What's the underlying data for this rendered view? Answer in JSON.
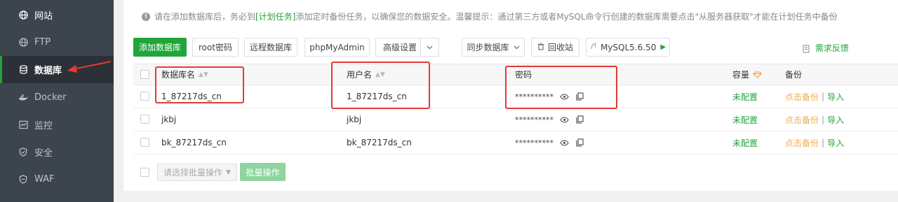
{
  "sidebar": {
    "items": [
      {
        "label": "网站",
        "icon": "globe-icon"
      },
      {
        "label": "FTP",
        "icon": "globe-icon"
      },
      {
        "label": "数据库",
        "icon": "database-icon",
        "active": true
      },
      {
        "label": "Docker",
        "icon": "docker-icon"
      },
      {
        "label": "监控",
        "icon": "monitor-icon"
      },
      {
        "label": "安全",
        "icon": "shield-icon"
      },
      {
        "label": "WAF",
        "icon": "waf-shield-icon"
      }
    ]
  },
  "notice": {
    "prefix": "请在添加数据库后，务必到",
    "link": "[计划任务]",
    "suffix": "添加定时备份任务，以确保您的数据安全。温馨提示：通过第三方或者MySQL命令行创建的数据库需要点击\"从服务器获取\"才能在计划任务中备份"
  },
  "toolbar": {
    "add_db": "添加数据库",
    "root_pwd": "root密码",
    "remote_db": "远程数据库",
    "phpmyadmin": "phpMyAdmin",
    "advanced": "高级设置",
    "sync_db": "同步数据库",
    "recycle_bin": "回收站",
    "mysql_version": "MySQL5.6.50",
    "feedback": "需求反馈"
  },
  "table": {
    "headers": {
      "db_name": "数据库名",
      "username": "用户名",
      "password": "密码",
      "capacity": "容量",
      "backup": "备份"
    },
    "rows": [
      {
        "db_name": "1_87217ds_cn",
        "username": "1_87217ds_cn",
        "password": "**********",
        "capacity": "未配置",
        "backup_action": "点击备份",
        "import": "导入"
      },
      {
        "db_name": "jkbj",
        "username": "jkbj",
        "password": "**********",
        "capacity": "未配置",
        "backup_action": "点击备份",
        "import": "导入"
      },
      {
        "db_name": "bk_87217ds_cn",
        "username": "bk_87217ds_cn",
        "password": "**********",
        "capacity": "未配置",
        "backup_action": "点击备份",
        "import": "导入"
      }
    ]
  },
  "batch": {
    "select_placeholder": "请选择批量操作",
    "button": "批量操作"
  },
  "colors": {
    "accent": "#20a53a",
    "annotation": "#e53935",
    "sidebar_bg": "#3c444d"
  }
}
